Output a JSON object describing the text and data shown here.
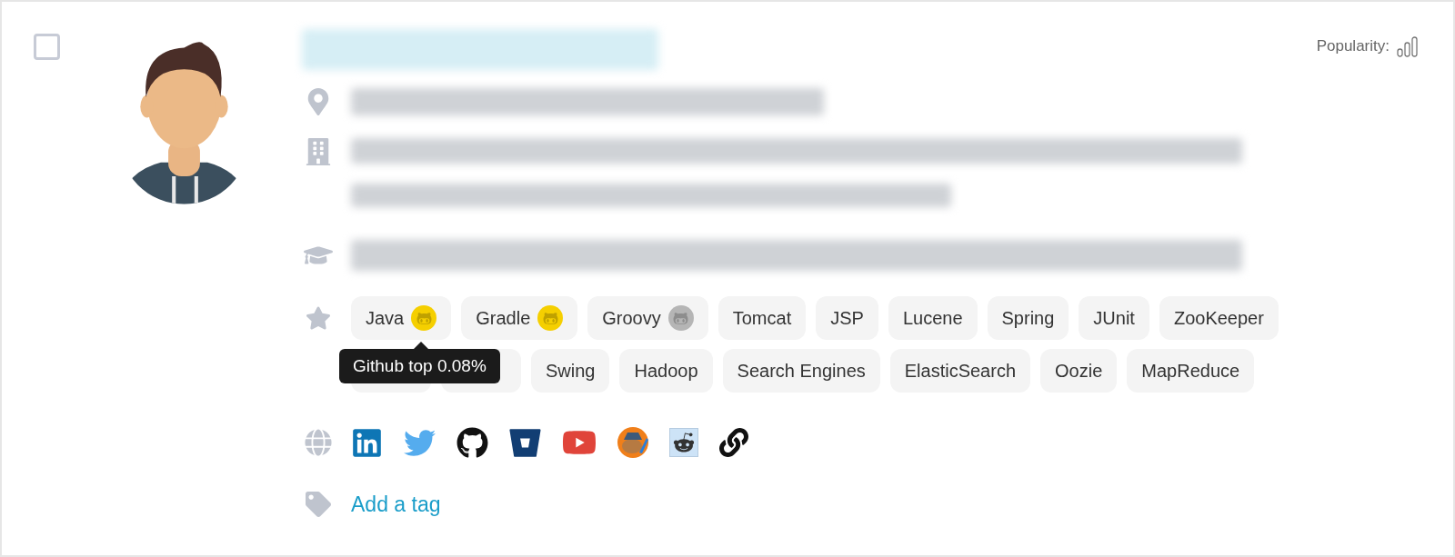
{
  "selection": {
    "checked": false
  },
  "popularity": {
    "label": "Popularity:"
  },
  "skills": [
    {
      "label": "Java",
      "color": "#f5cf00",
      "tooltip": "Github top 0.08%"
    },
    {
      "label": "Gradle",
      "color": "#f5cf00"
    },
    {
      "label": "Groovy",
      "color": "#b5b5b5"
    },
    {
      "label": "Tomcat"
    },
    {
      "label": "JSP"
    },
    {
      "label": "Lucene"
    },
    {
      "label": "Spring"
    },
    {
      "label": "JUnit"
    },
    {
      "label": "ZooKeeper"
    },
    {
      "kind": "covered"
    },
    {
      "kind": "covered"
    },
    {
      "label": "Swing"
    },
    {
      "label": "Hadoop"
    },
    {
      "label": "Search Engines"
    },
    {
      "label": "ElasticSearch"
    },
    {
      "label": "Oozie"
    },
    {
      "label": "MapReduce"
    }
  ],
  "add_tag": {
    "label": "Add a tag"
  }
}
